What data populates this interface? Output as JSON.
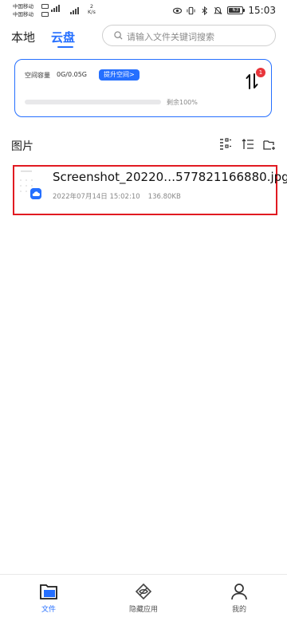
{
  "status_bar": {
    "carrier_1": "中国移动",
    "carrier_2": "中国移动",
    "net_speed_value": "2",
    "net_speed_unit": "K/s",
    "battery": "63",
    "time": "15:03"
  },
  "tabs": [
    {
      "label": "本地",
      "active": false
    },
    {
      "label": "云盘",
      "active": true
    }
  ],
  "search": {
    "placeholder": "请输入文件关键词搜索"
  },
  "storage": {
    "label": "空间容量",
    "value": "0G/0.05G",
    "upgrade_label": "提升空间>",
    "remaining_text": "剩余100%",
    "used_fraction": 0.0,
    "transfer_badge": "1"
  },
  "section": {
    "title": "图片"
  },
  "files": [
    {
      "name": "Screenshot_20220…577821166880.jpg",
      "date": "2022年07月14日 15:02:10",
      "size": "136.80KB"
    }
  ],
  "bottom_nav": [
    {
      "label": "文件",
      "icon": "folder-icon",
      "active": true
    },
    {
      "label": "隐藏应用",
      "icon": "hidden-eye-icon",
      "active": false
    },
    {
      "label": "我的",
      "icon": "person-icon",
      "active": false
    }
  ],
  "colors": {
    "accent": "#256fff",
    "highlight_border": "#e11a22",
    "badge": "#e8353b"
  }
}
